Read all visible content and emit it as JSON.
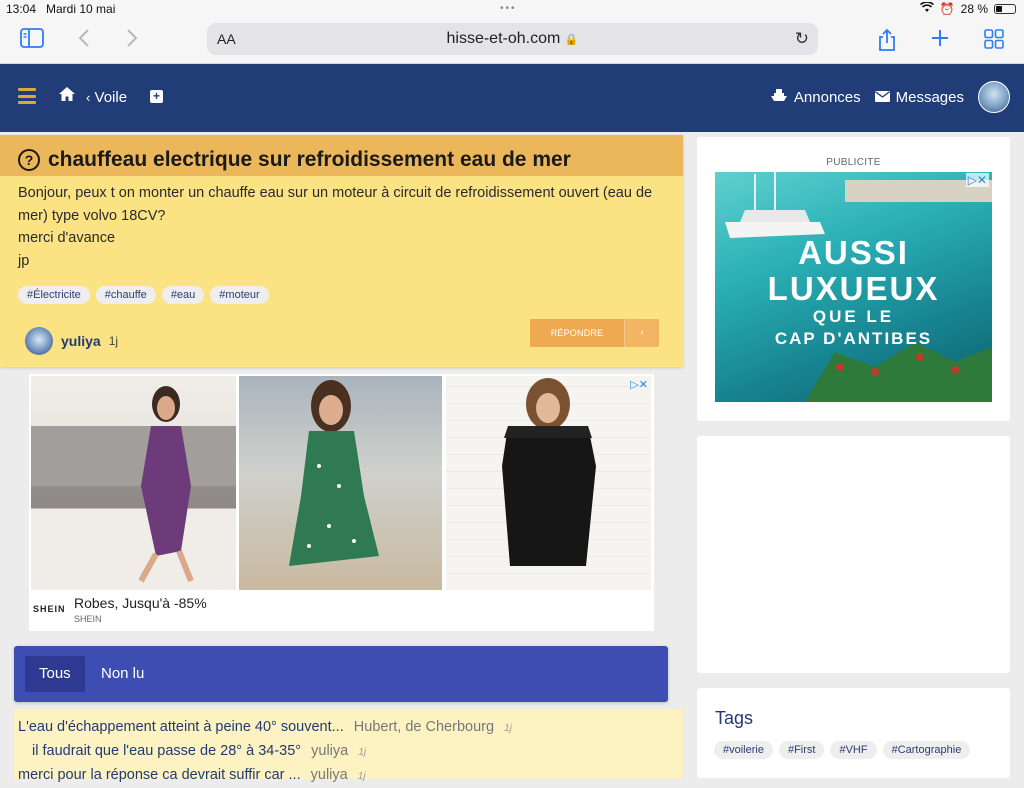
{
  "status_bar": {
    "time": "13:04",
    "date": "Mardi 10 mai",
    "battery": "28 %"
  },
  "browser": {
    "text_size_label": "AA",
    "url": "hisse-et-oh.com"
  },
  "header": {
    "breadcrumb": "Voile",
    "annonces_label": "Annonces",
    "messages_label": "Messages",
    "colors": {
      "bar": "#213d77",
      "accent": "#e2a53a"
    }
  },
  "question": {
    "title": "chauffeau electrique sur refroidissement eau de mer",
    "body_lines": [
      "Bonjour, peux t on monter un chauffe eau sur un moteur à circuit de refroidissement ouvert (eau de",
      "mer) type volvo 18CV?",
      "merci d'avance",
      "jp"
    ],
    "tags": [
      "#Électricite",
      "#chauffe",
      "#eau",
      "#moteur"
    ],
    "author": "yuliya",
    "age": "1j",
    "reply_label": "RÉPONDRE",
    "reply_menu_glyph": "‹"
  },
  "ad": {
    "brand": "SHEIN",
    "title": "Robes, Jusqu'à -85%",
    "source": "SHEIN"
  },
  "filter": {
    "tabs": [
      "Tous",
      "Non lu"
    ],
    "active": "Tous"
  },
  "threads": [
    {
      "title": "L'eau d'échappement atteint à peine 40° souvent...",
      "by": "Hubert, de Cherbourg",
      "ago": "1j"
    },
    {
      "title": "il faudrait que l'eau passe de 28° à 34-35°",
      "by": "yuliya",
      "ago": "1j"
    },
    {
      "title": "merci pour la réponse ca devrait suffir car ...",
      "by": "yuliya",
      "ago": "1j"
    }
  ],
  "sidebar": {
    "ad_label": "PUBLICITE",
    "banner_lines": [
      "AUSSI",
      "LUXUEUX",
      "QUE LE",
      "CAP D'ANTIBES"
    ],
    "tags_title": "Tags",
    "tags": [
      "#voilerie",
      "#First",
      "#VHF",
      "#Cartographie"
    ]
  }
}
